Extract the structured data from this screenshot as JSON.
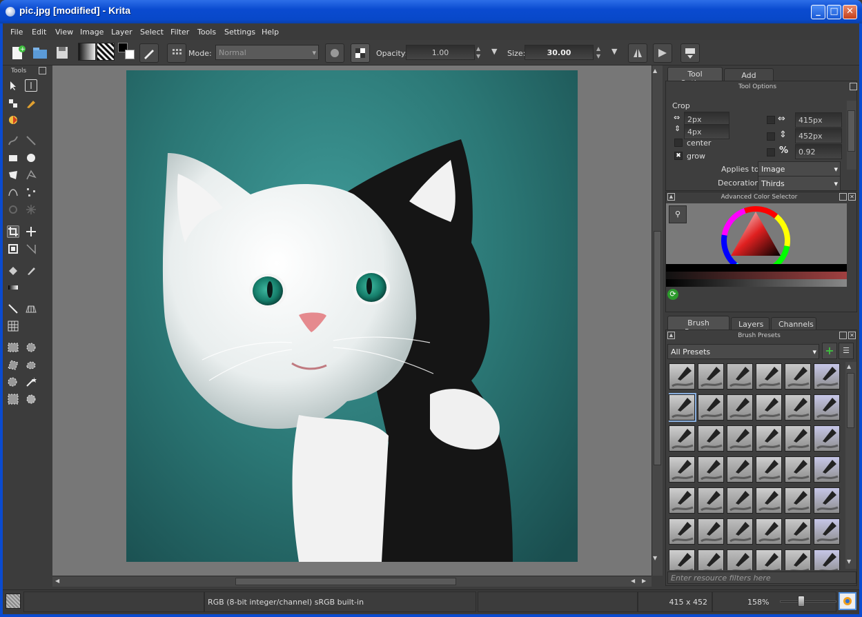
{
  "window": {
    "title": "pic.jpg [modified] - Krita"
  },
  "menubar": [
    "File",
    "Edit",
    "View",
    "Image",
    "Layer",
    "Select",
    "Filter",
    "Tools",
    "Settings",
    "Help"
  ],
  "toolbar": {
    "mode_label": "Mode:",
    "mode_value": "Normal",
    "opacity_label": "Opacity:",
    "opacity_value": "1.00",
    "size_label": "Size:",
    "size_value": "30.00"
  },
  "tools_dock": {
    "title": "Tools"
  },
  "tool_options": {
    "tabs": [
      "Tool Options",
      "Add Shape"
    ],
    "header": "Tool Options",
    "section": "Crop",
    "x_value": "2px",
    "y_value": "4px",
    "width_value": "415px",
    "height_value": "452px",
    "ratio_symbol": "%",
    "ratio_value": "0.92",
    "center_label": "center",
    "grow_label": "grow",
    "applies_to_label": "Applies to:",
    "applies_to_value": "Image",
    "decoration_label": "Decoration:",
    "decoration_value": "Thirds"
  },
  "color_selector": {
    "title": "Advanced Color Selector"
  },
  "brush_presets": {
    "tabs": [
      "Brush Presets",
      "Layers",
      "Channels"
    ],
    "header": "Brush Presets",
    "filter_value": "All Presets",
    "search_placeholder": "Enter resource filters here"
  },
  "statusbar": {
    "color_space": "RGB (8-bit integer/channel)  sRGB built-in",
    "dimensions": "415 x 452",
    "zoom": "158%"
  }
}
